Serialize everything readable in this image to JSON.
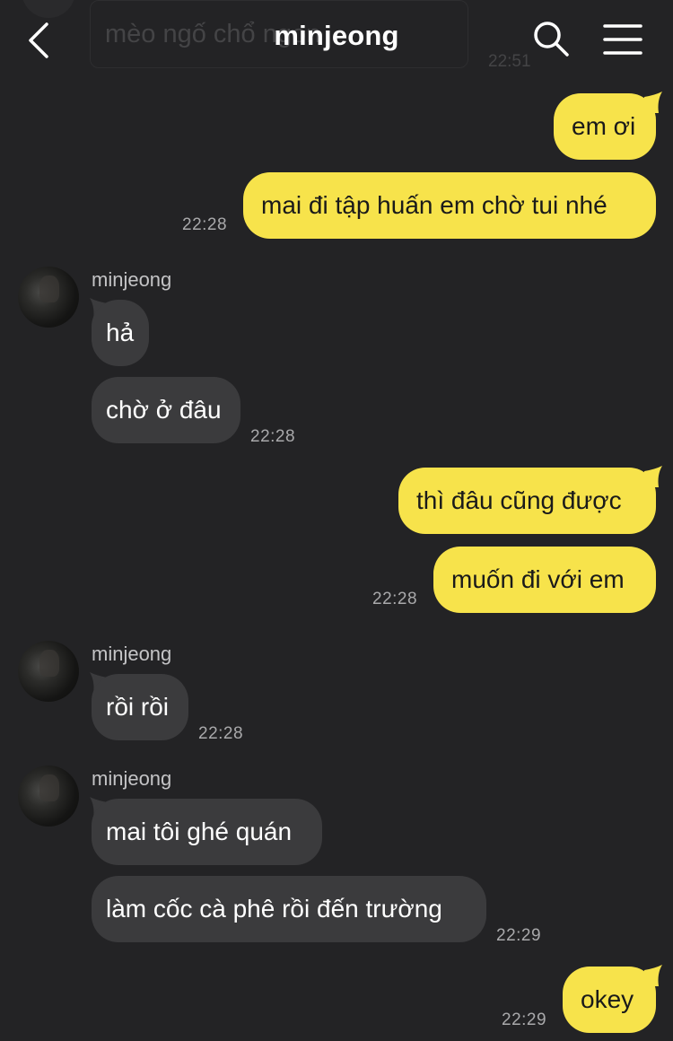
{
  "header": {
    "title": "minjeong",
    "ghost_message": "mèo ngố chổ             ngon",
    "ghost_time": "22:51"
  },
  "messages": [
    {
      "dir": "out",
      "text": "em ơi"
    },
    {
      "dir": "out",
      "text": "mai đi tập huấn em chờ tui nhé",
      "time": "22:28"
    },
    {
      "dir": "in",
      "sender": "minjeong",
      "text": "hả"
    },
    {
      "dir": "in",
      "text": "chờ ở đâu",
      "time": "22:28"
    },
    {
      "dir": "out",
      "text": "thì đâu cũng được"
    },
    {
      "dir": "out",
      "text": "muốn đi với em",
      "time": "22:28"
    },
    {
      "dir": "in",
      "sender": "minjeong",
      "text": "rồi rồi",
      "time": "22:28"
    },
    {
      "dir": "in",
      "sender": "minjeong",
      "text": "mai tôi ghé quán"
    },
    {
      "dir": "in",
      "text": "làm cốc cà phê rồi đến trường",
      "time": "22:29"
    },
    {
      "dir": "out",
      "text": "okey",
      "time": "22:29"
    }
  ],
  "colors": {
    "background": "#232325",
    "outgoing_bubble": "#f7e34b",
    "incoming_bubble": "#3b3b3d"
  },
  "icons": [
    "back-arrow-icon",
    "search-icon",
    "menu-icon"
  ]
}
